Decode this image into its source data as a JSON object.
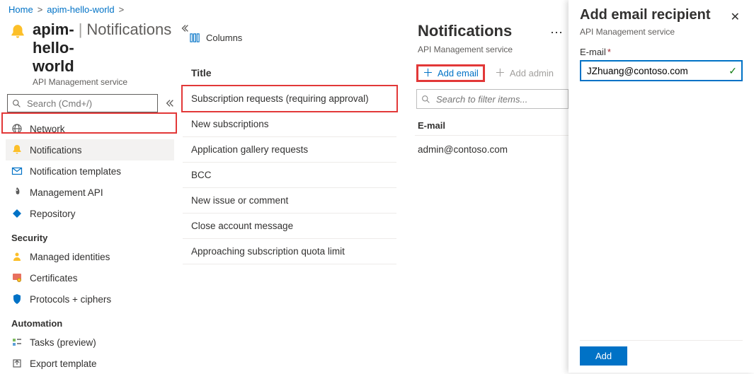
{
  "breadcrumb": {
    "home": "Home",
    "resource": "apim-hello-world"
  },
  "resource": {
    "title": "apim-hello-world",
    "section_title": "Notifications",
    "type": "API Management service"
  },
  "search": {
    "placeholder": "Search (Cmd+/)"
  },
  "menu": {
    "items": [
      {
        "label": "Network",
        "icon": "network"
      },
      {
        "label": "Notifications",
        "icon": "bell",
        "selected": true
      },
      {
        "label": "Notification templates",
        "icon": "mail"
      },
      {
        "label": "Management API",
        "icon": "rocket"
      },
      {
        "label": "Repository",
        "icon": "diamond"
      }
    ],
    "security_header": "Security",
    "security": [
      {
        "label": "Managed identities",
        "icon": "identity"
      },
      {
        "label": "Certificates",
        "icon": "certificate"
      },
      {
        "label": "Protocols + ciphers",
        "icon": "shield"
      }
    ],
    "automation_header": "Automation",
    "automation": [
      {
        "label": "Tasks (preview)",
        "icon": "tasks"
      },
      {
        "label": "Export template",
        "icon": "export"
      }
    ]
  },
  "mid": {
    "columns_label": "Columns",
    "title_header": "Title",
    "rows": [
      "Subscription requests (requiring approval)",
      "New subscriptions",
      "Application gallery requests",
      "BCC",
      "New issue or comment",
      "Close account message",
      "Approaching subscription quota limit"
    ],
    "selected": 0
  },
  "detail": {
    "title": "Notifications",
    "type": "API Management service",
    "add_email": "Add email",
    "add_admin": "Add admin",
    "filter_placeholder": "Search to filter items...",
    "column": "E-mail",
    "emails": [
      "admin@contoso.com"
    ]
  },
  "flyout": {
    "title": "Add email recipient",
    "subtitle": "API Management service",
    "field_label": "E-mail",
    "value": "JZhuang@contoso.com",
    "add_button": "Add"
  }
}
